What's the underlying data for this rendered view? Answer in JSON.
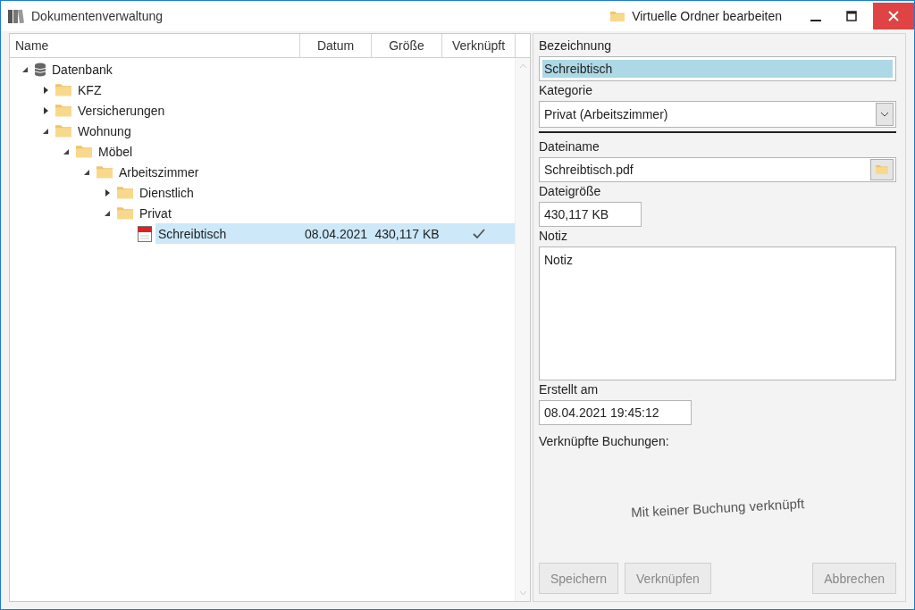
{
  "window": {
    "title": "Dokumentenverwaltung",
    "action": "Virtuelle Ordner bearbeiten"
  },
  "tree": {
    "columns": [
      "Name",
      "Datum",
      "Größe",
      "Verknüpft"
    ],
    "nodes": [
      {
        "label": "Datenbank",
        "kind": "database",
        "expanded": true,
        "selected": false,
        "children": [
          {
            "label": "KFZ",
            "kind": "folder",
            "expanded": false,
            "selected": false
          },
          {
            "label": "Versicherungen",
            "kind": "folder",
            "expanded": false,
            "selected": false
          },
          {
            "label": "Wohnung",
            "kind": "folder",
            "expanded": true,
            "selected": false,
            "children": [
              {
                "label": "Möbel",
                "kind": "folder",
                "expanded": true,
                "selected": false,
                "children": [
                  {
                    "label": "Arbeitszimmer",
                    "kind": "folder",
                    "expanded": true,
                    "selected": false,
                    "children": [
                      {
                        "label": "Dienstlich",
                        "kind": "folder",
                        "expanded": false,
                        "selected": false
                      },
                      {
                        "label": "Privat",
                        "kind": "folder",
                        "expanded": true,
                        "selected": false,
                        "children": [
                          {
                            "label": "Schreibtisch",
                            "kind": "pdf",
                            "selected": true,
                            "date": "08.04.2021",
                            "size": "430,117 KB",
                            "linked": true
                          }
                        ]
                      }
                    ]
                  }
                ]
              }
            ]
          }
        ]
      }
    ]
  },
  "details": {
    "name_label": "Bezeichnung",
    "name_value": "Schreibtisch",
    "category_label": "Kategorie",
    "category_value": "Privat (Arbeitszimmer)",
    "file_label": "Dateiname",
    "file_value": "Schreibtisch.pdf",
    "size_label": "Dateigröße",
    "size_value": "430,117 KB",
    "note_label": "Notiz",
    "note_value": "Notiz",
    "created_label": "Erstellt am",
    "created_value": "08.04.2021 19:45:12",
    "bookings_label": "Verknüpfte Buchungen:",
    "bookings_empty": "Mit keiner Buchung verknüpft"
  },
  "buttons": [
    {
      "label": "Speichern",
      "disabled": true
    },
    {
      "label": "Verknüpfen",
      "disabled": true
    },
    {
      "label": "Abbrechen",
      "disabled": true
    }
  ]
}
